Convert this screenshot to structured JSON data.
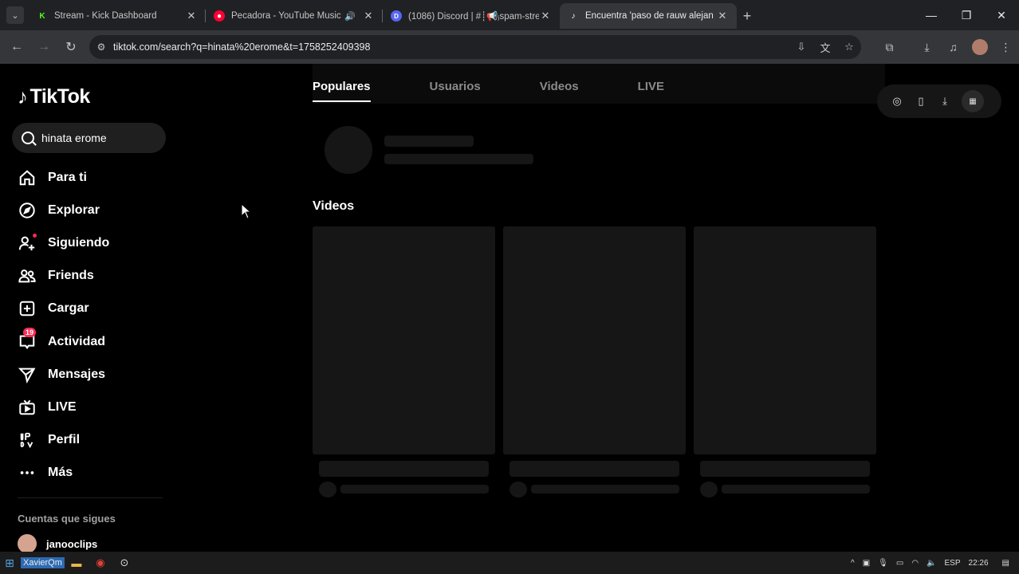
{
  "browser": {
    "tabs": [
      {
        "title": "Stream - Kick Dashboard",
        "icon": "kick-logo",
        "color": "#53fc18",
        "active": false
      },
      {
        "title": "Pecadora - YouTube Music",
        "icon": "youtube-music-logo",
        "color": "#ff0033",
        "active": false,
        "audio": true
      },
      {
        "title": "(1086) Discord | #┊📢ⱼspam-stre",
        "icon": "discord-logo",
        "color": "#5865f2",
        "active": false
      },
      {
        "title": "Encuentra 'paso de rauw alejan",
        "icon": "tiktok-logo",
        "color": "#ffffff",
        "active": true
      }
    ],
    "url": "tiktok.com/search?q=hinata%20erome&t=1758252409398"
  },
  "sidebar": {
    "logo": "TikTok",
    "search_value": "hinata erome",
    "nav": [
      {
        "label": "Para ti",
        "icon": "home-icon"
      },
      {
        "label": "Explorar",
        "icon": "compass-icon"
      },
      {
        "label": "Siguiendo",
        "icon": "following-icon"
      },
      {
        "label": "Friends",
        "icon": "friends-icon"
      },
      {
        "label": "Cargar",
        "icon": "upload-icon"
      },
      {
        "label": "Actividad",
        "icon": "activity-icon",
        "badge": "19"
      },
      {
        "label": "Mensajes",
        "icon": "messages-icon"
      },
      {
        "label": "LIVE",
        "icon": "live-icon"
      },
      {
        "label": "Perfil",
        "icon": "profile-icon"
      },
      {
        "label": "Más",
        "icon": "more-icon"
      }
    ],
    "following_title": "Cuentas que sigues",
    "following": [
      {
        "name": "janooclips"
      }
    ]
  },
  "search_tabs": [
    "Populares",
    "Usuarios",
    "Videos",
    "LIVE"
  ],
  "active_search_tab": "Populares",
  "videos_heading": "Videos",
  "taskbar": {
    "user_label": "XavierQm",
    "lang": "ESP",
    "time": "22:26"
  },
  "colors": {
    "accent": "#fe2c55",
    "skeleton": "#161616",
    "background": "#000000"
  }
}
